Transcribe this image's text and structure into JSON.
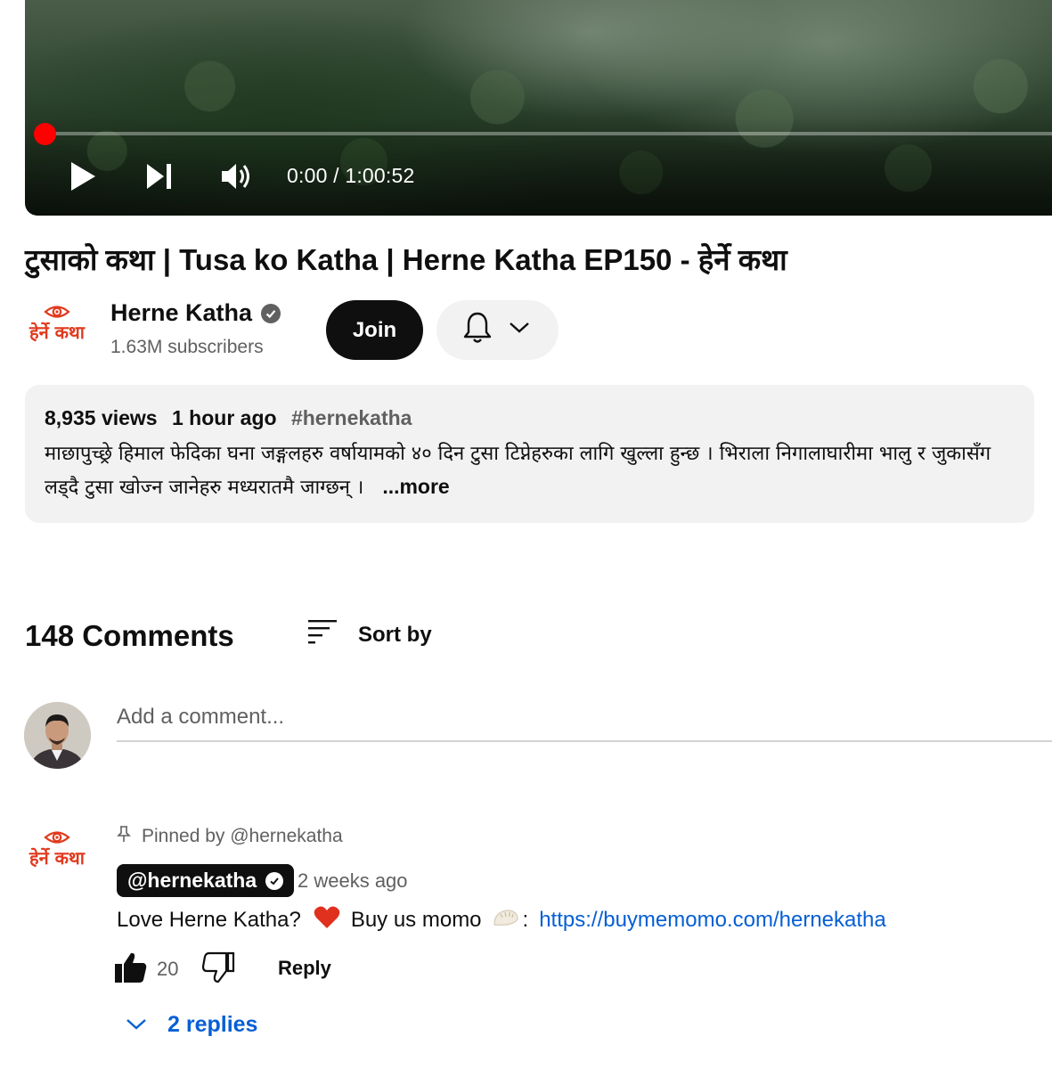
{
  "player": {
    "time_display": "0:00 / 1:00:52",
    "progress_fraction": 0.0,
    "icons": [
      "play-icon",
      "skip-next-icon",
      "volume-icon"
    ]
  },
  "video": {
    "title": "टुसाको कथा | Tusa ko Katha | Herne Katha EP150 - हेर्ने कथा"
  },
  "channel": {
    "logo_text": "हेर्ने कथा",
    "name": "Herne Katha",
    "subscribers": "1.63M subscribers",
    "join_label": "Join"
  },
  "description": {
    "views": "8,935 views",
    "age": "1 hour ago",
    "hashtag": "#hernekatha",
    "text": "माछापुच्छ्रे हिमाल फेदिका घना जङ्गलहरु वर्षायामको ४० दिन टुसा टिप्नेहरुका लागि खुल्ला हुन्छ । भिराला निगालाघारीमा भालु र जुकासँग लड्दै टुसा खोज्न जानेहरु मध्यरातमै जाग्छन् ।",
    "more_label": "...more"
  },
  "comments": {
    "count_label": "148 Comments",
    "sort_label": "Sort by",
    "add_placeholder": "Add a comment..."
  },
  "pinned_comment": {
    "pinned_label": "Pinned by @hernekatha",
    "author": "@hernekatha",
    "time": "2 weeks ago",
    "text_before": "Love Herne Katha?",
    "heart_emoji": "❤️",
    "text_middle": "Buy us momo",
    "momo_emoji": "🥟",
    "colon": ":",
    "link": "https://buymemomo.com/hernekatha",
    "likes": "20",
    "reply_label": "Reply",
    "replies_label": "2 replies"
  },
  "colors": {
    "accent_red": "#ff0000",
    "brand_logo": "#e03a1e",
    "link_blue": "#065fd4",
    "chip_bg": "#f2f2f2"
  }
}
